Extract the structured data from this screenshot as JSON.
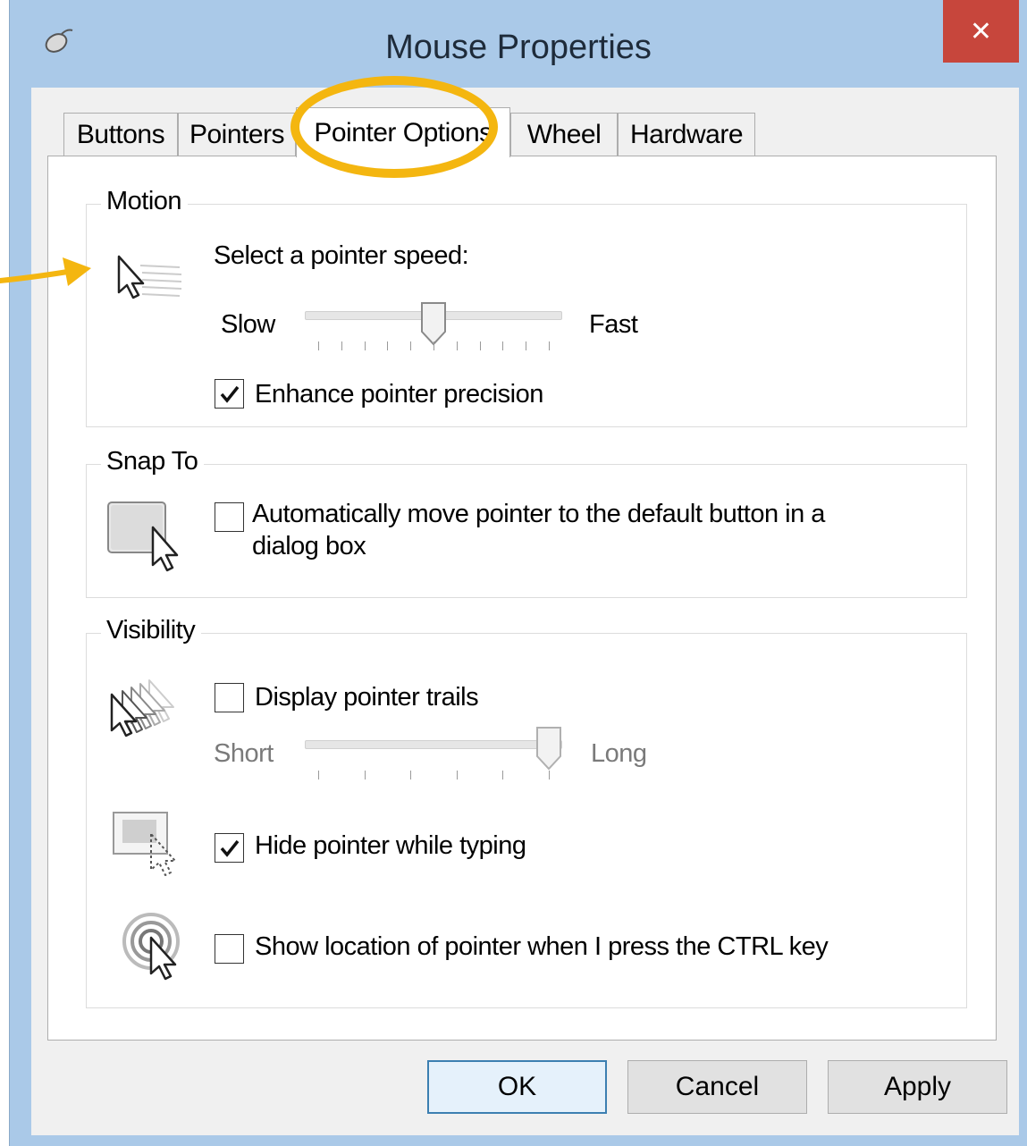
{
  "window": {
    "title": "Mouse Properties",
    "close_glyph": "✕",
    "app_icon": "mouse-icon"
  },
  "tabs": [
    {
      "label": "Buttons",
      "active": false
    },
    {
      "label": "Pointers",
      "active": false
    },
    {
      "label": "Pointer Options",
      "active": true
    },
    {
      "label": "Wheel",
      "active": false
    },
    {
      "label": "Hardware",
      "active": false
    }
  ],
  "motion": {
    "group_title": "Motion",
    "icon": "pointer-speed-icon",
    "prompt": "Select a pointer speed:",
    "slow_label": "Slow",
    "fast_label": "Fast",
    "speed_value": 0.5,
    "enhance_label": "Enhance pointer precision",
    "enhance_checked": true
  },
  "snap": {
    "group_title": "Snap To",
    "icon": "snap-to-default-button-icon",
    "label_line1": "Automatically move pointer to the default button in a",
    "label_line2": "dialog box",
    "checked": false
  },
  "visibility": {
    "group_title": "Visibility",
    "trails_icon": "pointer-trails-icon",
    "trails_label": "Display pointer trails",
    "trails_checked": false,
    "short_label": "Short",
    "long_label": "Long",
    "trails_value": 1.0,
    "hide_icon": "hide-pointer-icon",
    "hide_label": "Hide pointer while typing",
    "hide_checked": true,
    "ctrl_icon": "show-location-icon",
    "ctrl_label": "Show location of pointer when I press the CTRL key",
    "ctrl_checked": false
  },
  "buttons": {
    "ok": "OK",
    "cancel": "Cancel",
    "apply": "Apply"
  },
  "colors": {
    "titlebar": "#aac9e8",
    "close_button": "#c7463c",
    "annotation": "#f4b610",
    "default_button_border": "#3c7fb1"
  }
}
